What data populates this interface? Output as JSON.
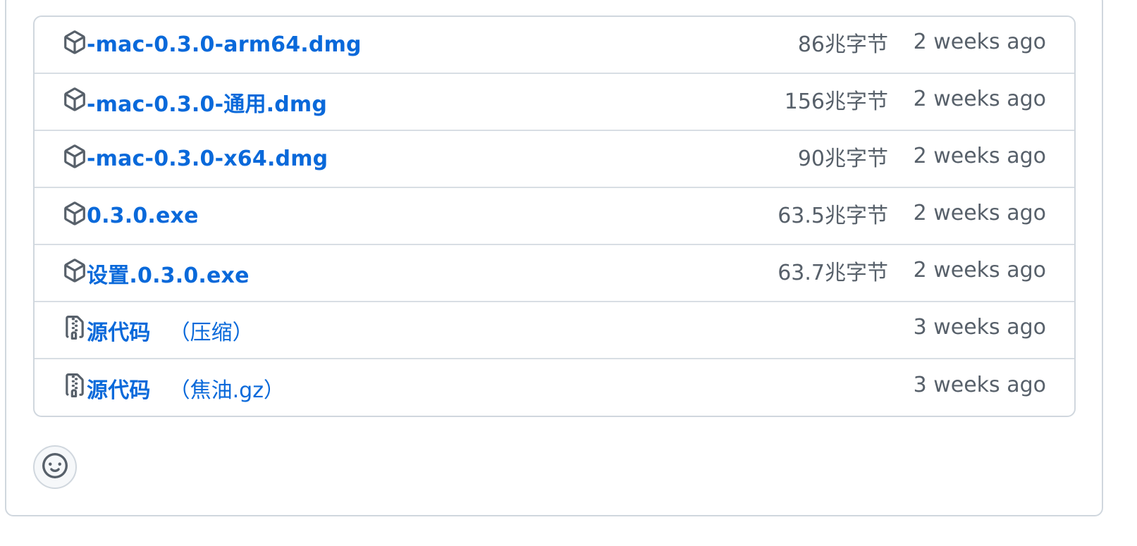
{
  "assets": [
    {
      "name": "-mac-0.3.0-arm64.dmg",
      "suffix": "",
      "size": "86兆字节",
      "date": "2 weeks ago",
      "icon": "package-icon"
    },
    {
      "name": "-mac-0.3.0-通用.dmg",
      "suffix": "",
      "size": "156兆字节",
      "date": "2 weeks ago",
      "icon": "package-icon"
    },
    {
      "name": "-mac-0.3.0-x64.dmg",
      "suffix": "",
      "size": "90兆字节",
      "date": "2 weeks ago",
      "icon": "package-icon"
    },
    {
      "name": "0.3.0.exe",
      "suffix": "",
      "size": "63.5兆字节",
      "date": "2 weeks ago",
      "icon": "package-icon"
    },
    {
      "name": "设置.0.3.0.exe",
      "suffix": "",
      "size": "63.7兆字节",
      "date": "2 weeks ago",
      "icon": "package-icon"
    },
    {
      "name": "源代码",
      "suffix": "（压缩）",
      "size": "",
      "date": "3 weeks ago",
      "icon": "file-zip-icon"
    },
    {
      "name": "源代码",
      "suffix": "（焦油.gz）",
      "size": "",
      "date": "3 weeks ago",
      "icon": "file-zip-icon"
    }
  ],
  "reactions": {
    "icon": "smiley-icon"
  },
  "colors": {
    "link": "#0969da",
    "muted": "#57606a",
    "border": "#d0d7de",
    "icon": "#57606a"
  }
}
